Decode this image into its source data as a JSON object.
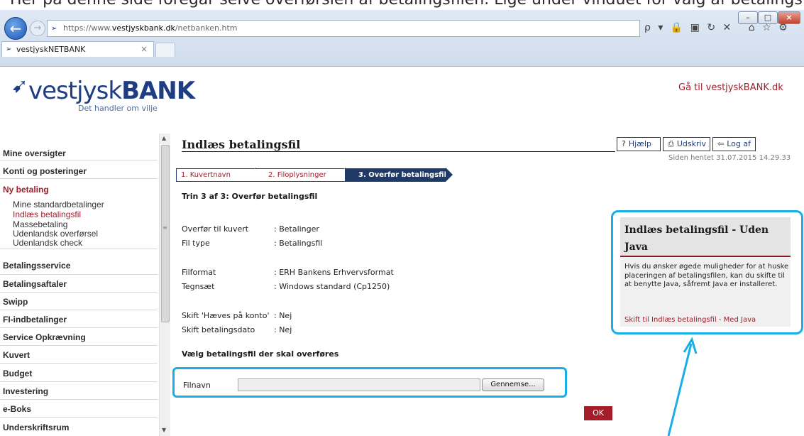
{
  "browser": {
    "url_prefix": "https://www.",
    "url_domain": "vestjyskbank.dk",
    "url_path": "/netbanken.htm",
    "tab_title": "vestjyskNETBANK",
    "tab_close": "×",
    "win_minimize": "–",
    "win_maximize": "□",
    "win_close": "×",
    "tools": "ρ ▾ 🔒 ▣ ↻ ✕",
    "home_icons": "⌂ ☆ ⚙"
  },
  "top_strip_text": "Her på denne side foregår selve overførslen af betalingsfilen. Lige under vinduet for valg af betalingsfil, finder du menuen, hvor du kan skifte til indlæsning",
  "header": {
    "logo_main": "vestjysk",
    "logo_bank": "BANK",
    "tagline": "Det handler om vilje",
    "goto_link": "Gå til vestjyskBANK.dk"
  },
  "sidebar": {
    "items": [
      {
        "label": "Mine oversigter"
      },
      {
        "label": "Konti og posteringer"
      },
      {
        "label": "Ny betaling"
      },
      {
        "label": "Betalingsservice"
      },
      {
        "label": "Betalingsaftaler"
      },
      {
        "label": "Swipp"
      },
      {
        "label": "FI-indbetalinger"
      },
      {
        "label": "Service Opkrævning"
      },
      {
        "label": "Kuvert"
      },
      {
        "label": "Budget"
      },
      {
        "label": "Investering"
      },
      {
        "label": "e-Boks"
      },
      {
        "label": "Underskriftsrum"
      }
    ],
    "sub_items": [
      {
        "label": "Mine standardbetalinger"
      },
      {
        "label": "Indlæs betalingsfil"
      },
      {
        "label": "Massebetaling"
      },
      {
        "label": "Udenlandsk overførsel"
      },
      {
        "label": "Udenlandsk check"
      }
    ]
  },
  "main": {
    "title": "Indlæs betalingsfil",
    "toolbar": {
      "help": "Hjælp",
      "print": "Udskriv",
      "logout": "Log af"
    },
    "retrieved": "Siden hentet 31.07.2015 14.29.33",
    "steps": [
      "1. Kuvertnavn",
      "2. Filoplysninger",
      "3. Overfør betalingsfil"
    ],
    "step_subtitle": "Trin 3 af 3: Overfør betalingsfil",
    "fields": [
      {
        "label": "Overfør til kuvert",
        "value": ": Betalinger"
      },
      {
        "label": "Fil type",
        "value": ": Betalingsfil"
      },
      {
        "label": "Filformat",
        "value": ": ERH Bankens Erhvervsformat"
      },
      {
        "label": "Tegnsæt",
        "value": ": Windows standard (Cp1250)"
      },
      {
        "label": "Skift 'Hæves på konto'",
        "value": ": Nej"
      },
      {
        "label": "Skift betalingsdato",
        "value": ": Nej"
      }
    ],
    "choose_heading": "Vælg betalingsfil der skal overføres",
    "file_label": "Filnavn",
    "file_value": "",
    "browse_label": "Gennemse...",
    "ok_label": "OK"
  },
  "help": {
    "title": "Indlæs betalingsfil - Uden Java",
    "body": "Hvis du ønsker øgede muligheder for at huske placeringen af betalingsfilen, kan du skifte til at benytte Java, såfremt Java er installeret.",
    "link": "Skift til Indlæs betalingsfil - Med Java"
  },
  "colors": {
    "brand_red": "#a0202b",
    "brand_blue": "#1e3d82",
    "highlight": "#1aaee8",
    "step_active": "#1f3a66"
  }
}
